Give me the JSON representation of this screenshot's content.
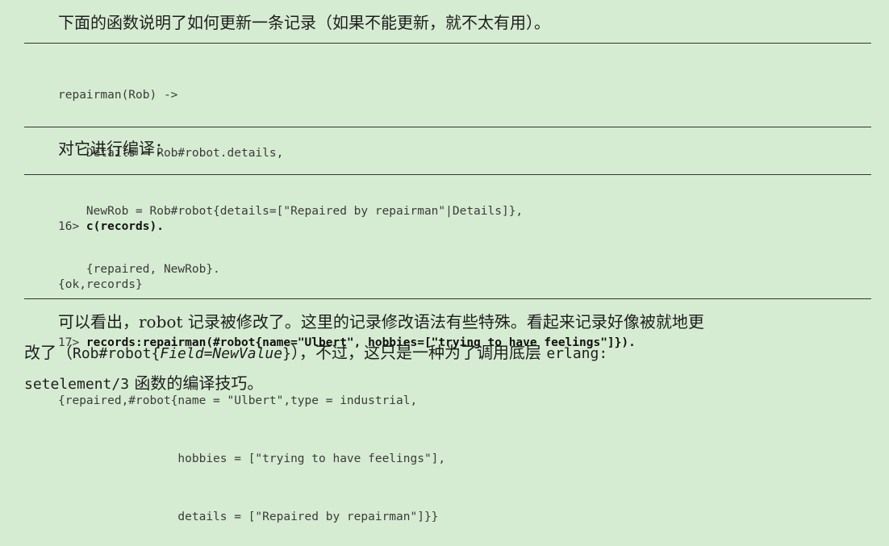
{
  "intro": "下面的函数说明了如何更新一条记录（如果不能更新，就不太有用）。",
  "code1": {
    "lines": [
      "repairman(Rob) ->",
      "    Details = Rob#robot.details,",
      "    NewRob = Rob#robot{details=[\"Repaired by repairman\"|Details]},",
      "    {repaired, NewRob}."
    ]
  },
  "compile_label": "对它进行编译：",
  "code2": {
    "prompt1": "16> ",
    "cmd1": "c(records).",
    "out1": "{ok,records}",
    "prompt2": "17> ",
    "cmd2": "records:repairman(#robot{name=\"Ulbert\", hobbies=[\"trying to have feelings\"]}).",
    "out2": "{repaired,#robot{name = \"Ulbert\",type = industrial,",
    "out3": "                 hobbies = [\"trying to have feelings\"],",
    "out4": "                 details = [\"Repaired by repairman\"]}}"
  },
  "conclusion": {
    "line1": "可以看出，robot 记录被修改了。这里的记录修改语法有些特殊。看起来记录好像被就地更",
    "line2_a": "改了（",
    "line2_code_pre": "Rob#robot{",
    "line2_code_italic": "Field",
    "line2_code_eq": "=",
    "line2_code_italic2": "NewValue",
    "line2_code_post": "}",
    "line2_b": "），不过，这只是一种为了调用底层 ",
    "line2_code_end": "erlang:",
    "line3_code": "setelement/3",
    "line3_text": " 函数的编译技巧。"
  }
}
